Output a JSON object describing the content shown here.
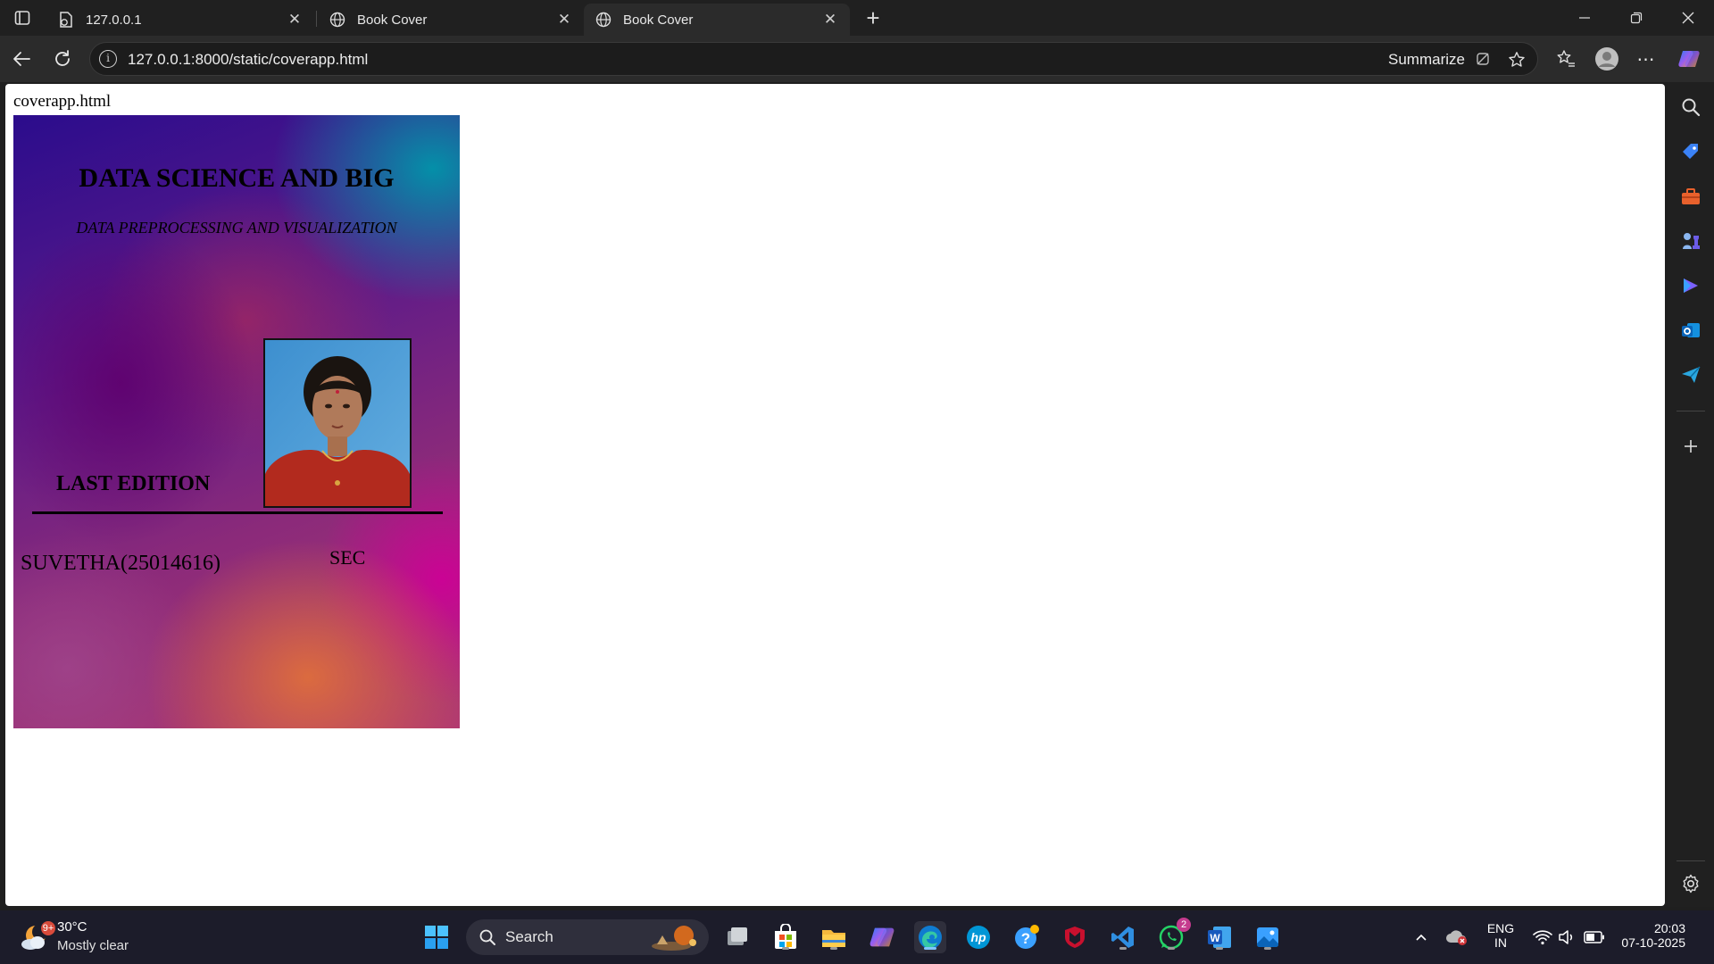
{
  "browser": {
    "tabs": [
      {
        "title": "127.0.0.1",
        "active": false
      },
      {
        "title": "Book Cover",
        "active": false
      },
      {
        "title": "Book Cover",
        "active": true
      }
    ],
    "address": "127.0.0.1:8000/static/coverapp.html",
    "summarize_label": "Summarize"
  },
  "page": {
    "heading": "coverapp.html",
    "cover": {
      "title": "DATA SCIENCE AND BIG",
      "subtitle": "DATA PREPROCESSING AND VISUALIZATION",
      "edition": "LAST EDITION",
      "author": "SUVETHA(25014616)",
      "college": "SEC"
    }
  },
  "taskbar": {
    "weather_temp": "30°C",
    "weather_desc": "Mostly clear",
    "weather_badge": "9+",
    "search_label": "Search",
    "whatsapp_badge": "2",
    "lang_top": "ENG",
    "lang_bottom": "IN",
    "time": "20:03",
    "date": "07-10-2025"
  },
  "colors": {
    "accent": "#0078d4",
    "taskbar": "#1c1c2a",
    "toolbar": "#2b2b2b"
  }
}
